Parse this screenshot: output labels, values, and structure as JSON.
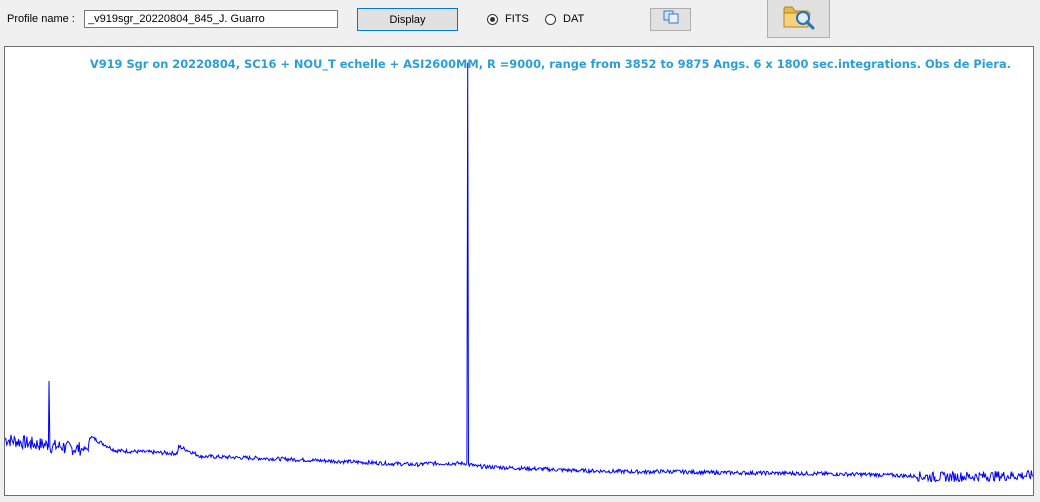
{
  "toolbar": {
    "profile_label": "Profile name :",
    "profile_value": "_v919sgr_20220804_845_J. Guarro",
    "display_label": "Display",
    "format_options": [
      {
        "label": "FITS",
        "selected": true
      },
      {
        "label": "DAT",
        "selected": false
      }
    ],
    "copy_icon": "copy-icon",
    "open_icon": "folder-search-icon"
  },
  "chart_data": {
    "type": "line",
    "title": "V919 Sgr on 20220804, SC16 + NOU_T echelle + ASI2600MM, R =9000, range from 3852 to 9875 Angs. 6 x 1800 sec.integrations. Obs de Piera.",
    "xlim": [
      3852,
      9875
    ],
    "series": [
      {
        "color": "#0000ff",
        "x": [
          3852,
          4000,
          4102,
          4110,
          4200,
          4340,
          4350,
          4500,
          4861,
          4870,
          5000,
          5500,
          5900,
          6100,
          6300,
          6563,
          6600,
          7000,
          7200,
          7600,
          7700,
          8000,
          8500,
          9000,
          9300,
          9600,
          9875
        ],
        "y": [
          1.75,
          1.6,
          1.55,
          3.8,
          1.45,
          1.4,
          1.85,
          1.35,
          1.25,
          1.5,
          1.15,
          1.05,
          0.95,
          0.9,
          0.85,
          15.0,
          0.8,
          0.7,
          0.65,
          0.6,
          0.62,
          0.58,
          0.55,
          0.5,
          0.42,
          0.45,
          0.48
        ]
      }
    ],
    "colors": {
      "line": "#0000ff",
      "title": "#2a9fd6"
    },
    "grid": false,
    "legend": "none"
  }
}
